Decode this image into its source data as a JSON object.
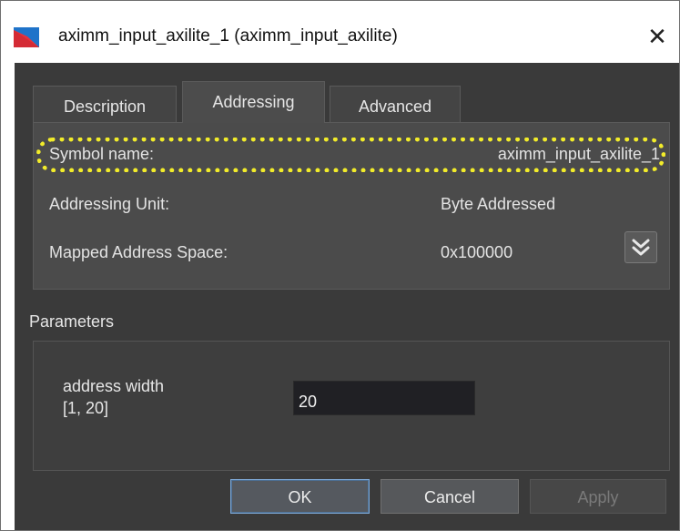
{
  "window": {
    "title": "aximm_input_axilite_1 (aximm_input_axilite)",
    "close_label": "✕"
  },
  "tabs": [
    {
      "label": "Description",
      "active": false
    },
    {
      "label": "Addressing",
      "active": true
    },
    {
      "label": "Advanced",
      "active": false
    }
  ],
  "addressing": {
    "rows": [
      {
        "label": "Symbol name:",
        "value": "aximm_input_axilite_1"
      },
      {
        "label": "Addressing Unit:",
        "value": "Byte Addressed"
      },
      {
        "label": "Mapped Address Space:",
        "value": "0x100000"
      }
    ],
    "expand_icon": "double-chevron-down-icon"
  },
  "parameters": {
    "section_label": "Parameters",
    "items": [
      {
        "name_line1": "address width",
        "name_line2": "[1, 20]",
        "value": "20"
      }
    ]
  },
  "buttons": {
    "ok": "OK",
    "cancel": "Cancel",
    "apply": "Apply"
  },
  "colors": {
    "highlight": "#f2ec2a",
    "background": "#3a3a3a",
    "panel": "#4b4b4b"
  }
}
